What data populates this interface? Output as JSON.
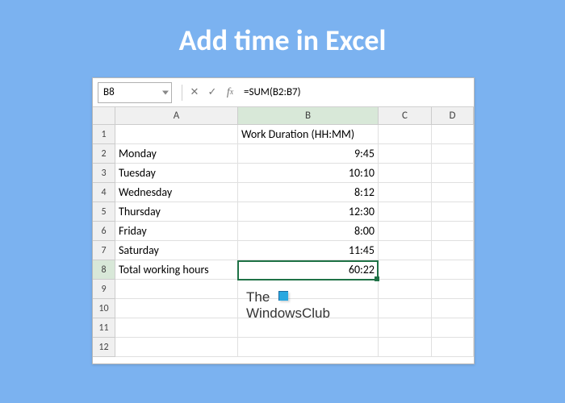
{
  "page_title": "Add time in Excel",
  "name_box": "B8",
  "formula": "=SUM(B2:B7)",
  "columns": [
    "A",
    "B",
    "C",
    "D"
  ],
  "row_numbers": [
    "1",
    "2",
    "3",
    "4",
    "5",
    "6",
    "7",
    "8",
    "9",
    "10",
    "11",
    "12"
  ],
  "header_cell": "Work Duration (HH:MM)",
  "rows": [
    {
      "label": "Monday",
      "value": "9:45"
    },
    {
      "label": "Tuesday",
      "value": "10:10"
    },
    {
      "label": "Wednesday",
      "value": "8:12"
    },
    {
      "label": "Thursday",
      "value": "12:30"
    },
    {
      "label": "Friday",
      "value": "8:00"
    },
    {
      "label": "Saturday",
      "value": "11:45"
    },
    {
      "label": "Total working hours",
      "value": "60:22"
    }
  ],
  "watermark": {
    "line1": "The",
    "line2": "WindowsClub"
  },
  "active": {
    "col": "B",
    "row": 8
  }
}
